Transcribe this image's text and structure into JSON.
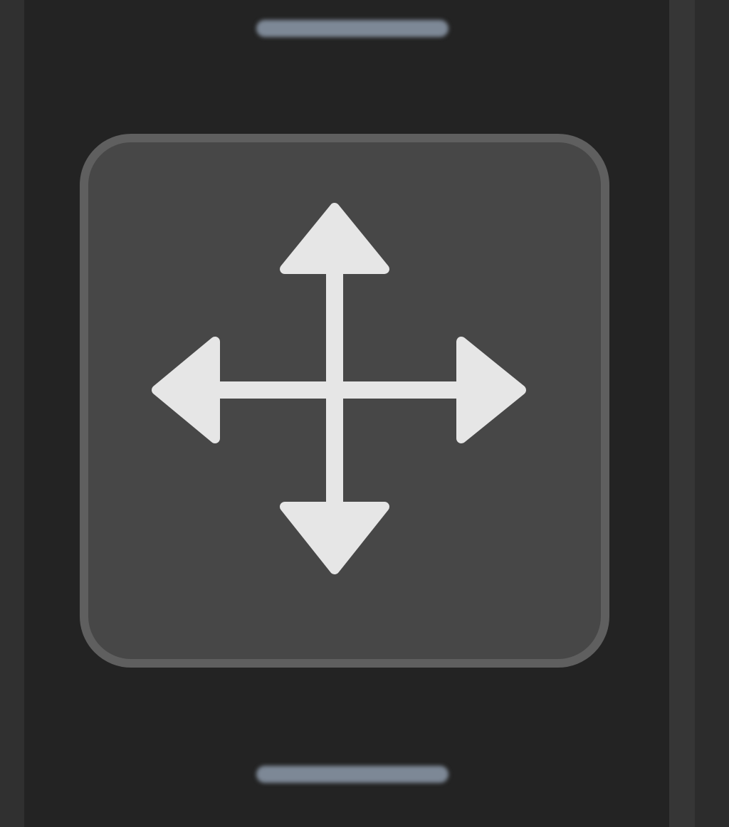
{
  "toolbar": {
    "active_tool": {
      "icon": "move-arrows-icon",
      "selected": true
    },
    "adjacent_tools": [
      {
        "position": "previous"
      },
      {
        "position": "next"
      }
    ]
  },
  "colors": {
    "background": "#232323",
    "button_fill": "#474747",
    "button_border": "#5f5f5f",
    "icon": "#e6e6e6",
    "sliver": "#7d8896"
  }
}
